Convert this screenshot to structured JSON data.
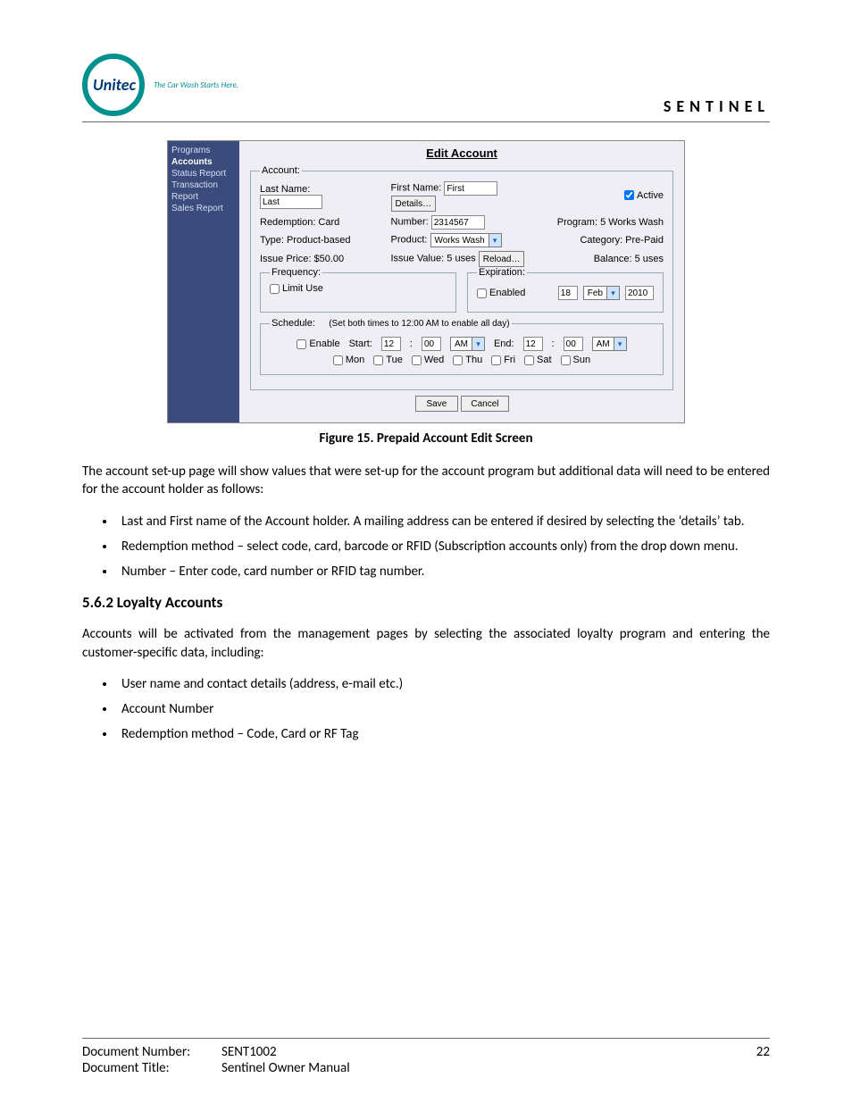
{
  "header": {
    "tagline": "The Car Wash Starts Here.",
    "brand": "SENTINEL"
  },
  "screenshot": {
    "sidebar": {
      "items": [
        "Programs",
        "Accounts",
        "Status Report",
        "Transaction Report",
        "Sales Report"
      ],
      "current": "Accounts"
    },
    "title": "Edit Account",
    "account": {
      "legend": "Account:",
      "last_name_label": "Last Name:",
      "last_name_value": "Last",
      "first_name_label": "First Name:",
      "first_name_value": "First",
      "details_btn": "Details…",
      "active_label": "Active",
      "redemption_label_value": "Redemption: Card",
      "number_label": "Number:",
      "number_value": "2314567",
      "program_label_value": "Program: 5 Works Wash",
      "type_label_value": "Type: Product-based",
      "product_label": "Product:",
      "product_value": "Works Wash",
      "category_label_value": "Category: Pre-Paid",
      "issue_price_label_value": "Issue Price: $50.00",
      "issue_value_label_value": "Issue Value: 5 uses",
      "reload_btn": "Reload…",
      "balance_label_value": "Balance: 5 uses"
    },
    "frequency": {
      "legend": "Frequency:",
      "limit_use_label": "Limit Use"
    },
    "expiration": {
      "legend": "Expiration:",
      "enabled_label": "Enabled",
      "day": "18",
      "month": "Feb",
      "year": "2010"
    },
    "schedule": {
      "legend": "Schedule:",
      "note": "(Set both times to 12:00 AM to enable all day)",
      "enable_label": "Enable",
      "start_label": "Start:",
      "end_label": "End:",
      "h1": "12",
      "m1": "00",
      "ap1": "AM",
      "h2": "12",
      "m2": "00",
      "ap2": "AM",
      "days": [
        "Mon",
        "Tue",
        "Wed",
        "Thu",
        "Fri",
        "Sat",
        "Sun"
      ]
    },
    "buttons": {
      "save": "Save",
      "cancel": "Cancel"
    }
  },
  "figure_caption": "Figure 15. Prepaid Account Edit Screen",
  "paragraphs": {
    "intro": "The account set-up page will show values that were set-up for the account program but additional data will need to be entered for the account holder as follows:",
    "bullets1": [
      "Last and First name of the Account holder. A mailing address can be entered if desired by selecting the ‘details’ tab.",
      "Redemption method – select code, card, barcode or RFID (Subscription accounts only) from the drop down menu.",
      "Number – Enter code, card number or RFID tag number."
    ],
    "section_heading": "5.6.2  Loyalty Accounts",
    "loyalty_intro": "Accounts will be activated from the management pages by selecting the associated loyalty program and entering the customer-specific data, including:",
    "bullets2": [
      "User name and contact details (address, e-mail etc.)",
      "Account Number",
      "Redemption method – Code, Card or RF Tag"
    ]
  },
  "footer": {
    "doc_num_label": "Document Number:",
    "doc_num_value": "SENT1002",
    "page_number": "22",
    "doc_title_label": "Document Title:",
    "doc_title_value": "Sentinel Owner Manual"
  }
}
